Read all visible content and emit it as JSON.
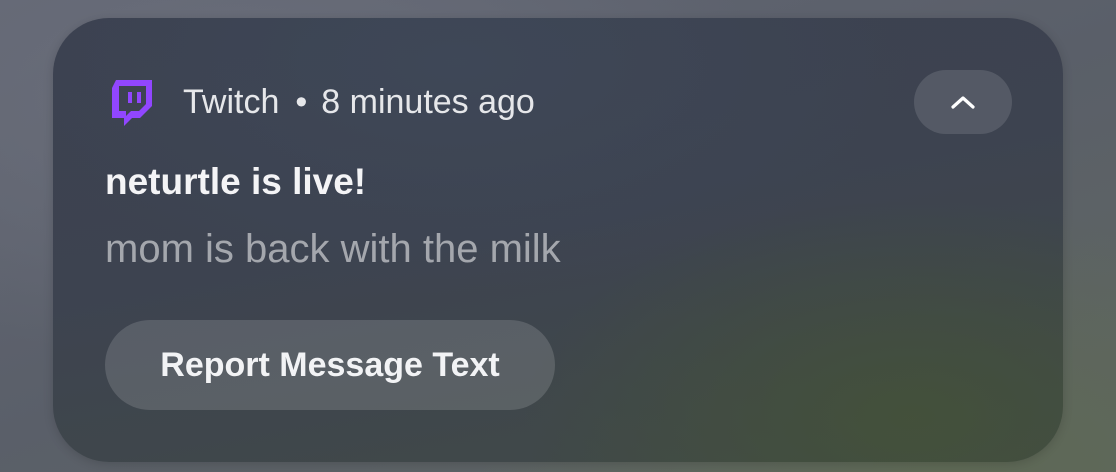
{
  "notification": {
    "app_name": "Twitch",
    "separator": "•",
    "timestamp": "8 minutes ago",
    "app_icon": "twitch-icon",
    "collapse_icon": "chevron-up-icon",
    "title": "neturtle is live!",
    "body": "mom is back with the milk",
    "action_label": "Report Message Text",
    "colors": {
      "brand": "#9146FF"
    }
  }
}
